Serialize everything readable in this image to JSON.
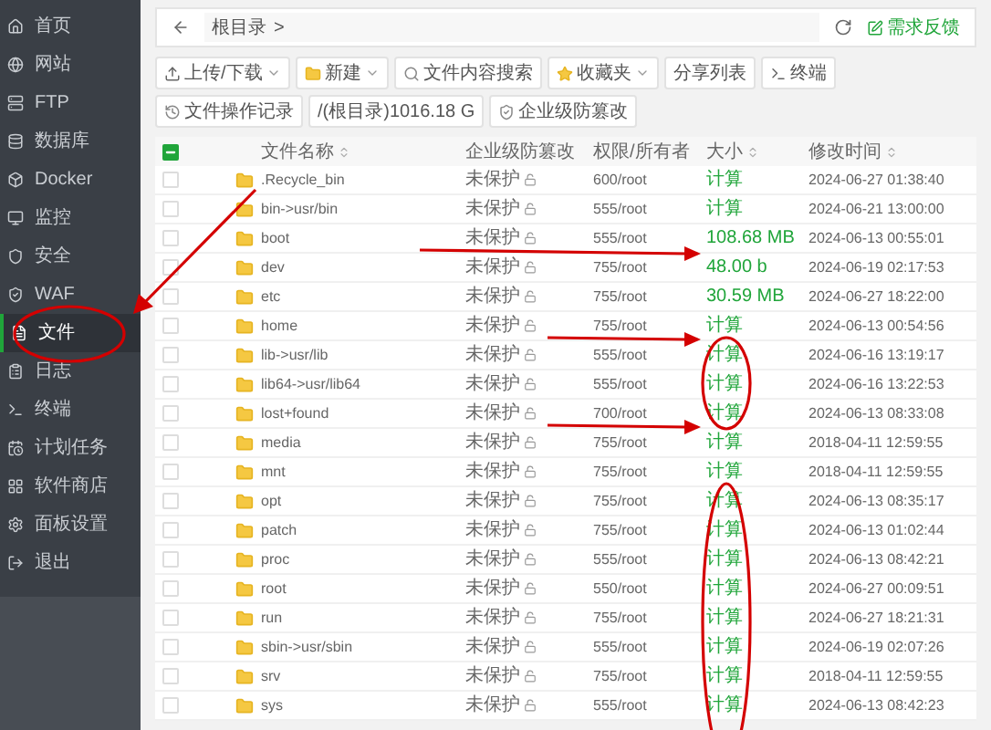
{
  "sidebar": {
    "items": [
      {
        "label": "首页",
        "selected": false
      },
      {
        "label": "网站",
        "selected": false
      },
      {
        "label": "FTP",
        "selected": false
      },
      {
        "label": "数据库",
        "selected": false
      },
      {
        "label": "Docker",
        "selected": false
      },
      {
        "label": "监控",
        "selected": false
      },
      {
        "label": "安全",
        "selected": false
      },
      {
        "label": "WAF",
        "selected": false
      },
      {
        "label": "文件",
        "selected": true
      },
      {
        "label": "日志",
        "selected": false
      },
      {
        "label": "终端",
        "selected": false
      },
      {
        "label": "计划任务",
        "selected": false
      },
      {
        "label": "软件商店",
        "selected": false
      },
      {
        "label": "面板设置",
        "selected": false
      },
      {
        "label": "退出",
        "selected": false
      }
    ]
  },
  "breadcrumb": {
    "path": "根目录",
    "separator": ">"
  },
  "feedback": "需求反馈",
  "toolbar": [
    {
      "label": "上传/下载",
      "dropdown": true
    },
    {
      "label": "新建",
      "dropdown": true
    },
    {
      "label": "文件内容搜索",
      "dropdown": false
    },
    {
      "label": "收藏夹",
      "dropdown": true
    },
    {
      "label": "分享列表",
      "dropdown": false
    },
    {
      "label": "终端",
      "dropdown": false
    },
    {
      "label": "文件操作记录",
      "dropdown": false
    },
    {
      "label": "/(根目录)1016.18 G",
      "dropdown": false
    },
    {
      "label": "企业级防篡改",
      "dropdown": false
    }
  ],
  "table": {
    "select_all": {
      "checked": true
    },
    "columns": [
      {
        "label": "文件名称",
        "sortable": true
      },
      {
        "label": "企业级防篡改",
        "sortable": false
      },
      {
        "label": "权限/所有者",
        "sortable": false
      },
      {
        "label": "大小",
        "sortable": true
      },
      {
        "label": "修改时间",
        "sortable": true
      }
    ],
    "rows": [
      {
        "checked": false,
        "name": ".Recycle_bin",
        "protection": "未保护",
        "permission": "600/root",
        "size": "计算",
        "modified": "2024-06-27 01:38:40"
      },
      {
        "checked": false,
        "name": "bin->usr/bin",
        "protection": "未保护",
        "permission": "555/root",
        "size": "计算",
        "modified": "2024-06-21 13:00:00"
      },
      {
        "checked": false,
        "name": "boot",
        "protection": "未保护",
        "permission": "555/root",
        "size": "108.68 MB",
        "modified": "2024-06-13 00:55:01"
      },
      {
        "checked": false,
        "name": "dev",
        "protection": "未保护",
        "permission": "755/root",
        "size": "48.00 b",
        "modified": "2024-06-19 02:17:53"
      },
      {
        "checked": false,
        "name": "etc",
        "protection": "未保护",
        "permission": "755/root",
        "size": "30.59 MB",
        "modified": "2024-06-27 18:22:00"
      },
      {
        "checked": false,
        "name": "home",
        "protection": "未保护",
        "permission": "755/root",
        "size": "计算",
        "modified": "2024-06-13 00:54:56"
      },
      {
        "checked": false,
        "name": "lib->usr/lib",
        "protection": "未保护",
        "permission": "555/root",
        "size": "计算",
        "modified": "2024-06-16 13:19:17"
      },
      {
        "checked": false,
        "name": "lib64->usr/lib64",
        "protection": "未保护",
        "permission": "555/root",
        "size": "计算",
        "modified": "2024-06-16 13:22:53"
      },
      {
        "checked": false,
        "name": "lost+found",
        "protection": "未保护",
        "permission": "700/root",
        "size": "计算",
        "modified": "2024-06-13 08:33:08"
      },
      {
        "checked": false,
        "name": "media",
        "protection": "未保护",
        "permission": "755/root",
        "size": "计算",
        "modified": "2018-04-11 12:59:55"
      },
      {
        "checked": false,
        "name": "mnt",
        "protection": "未保护",
        "permission": "755/root",
        "size": "计算",
        "modified": "2018-04-11 12:59:55"
      },
      {
        "checked": false,
        "name": "opt",
        "protection": "未保护",
        "permission": "755/root",
        "size": "计算",
        "modified": "2024-06-13 08:35:17"
      },
      {
        "checked": false,
        "name": "patch",
        "protection": "未保护",
        "permission": "755/root",
        "size": "计算",
        "modified": "2024-06-13 01:02:44"
      },
      {
        "checked": false,
        "name": "proc",
        "protection": "未保护",
        "permission": "555/root",
        "size": "计算",
        "modified": "2024-06-13 08:42:21"
      },
      {
        "checked": false,
        "name": "root",
        "protection": "未保护",
        "permission": "550/root",
        "size": "计算",
        "modified": "2024-06-27 00:09:51"
      },
      {
        "checked": false,
        "name": "run",
        "protection": "未保护",
        "permission": "755/root",
        "size": "计算",
        "modified": "2024-06-27 18:21:31"
      },
      {
        "checked": false,
        "name": "sbin->usr/sbin",
        "protection": "未保护",
        "permission": "555/root",
        "size": "计算",
        "modified": "2024-06-19 02:07:26"
      },
      {
        "checked": false,
        "name": "srv",
        "protection": "未保护",
        "permission": "755/root",
        "size": "计算",
        "modified": "2018-04-11 12:59:55"
      },
      {
        "checked": false,
        "name": "sys",
        "protection": "未保护",
        "permission": "555/root",
        "size": "计算",
        "modified": "2024-06-13 08:42:23"
      }
    ]
  }
}
